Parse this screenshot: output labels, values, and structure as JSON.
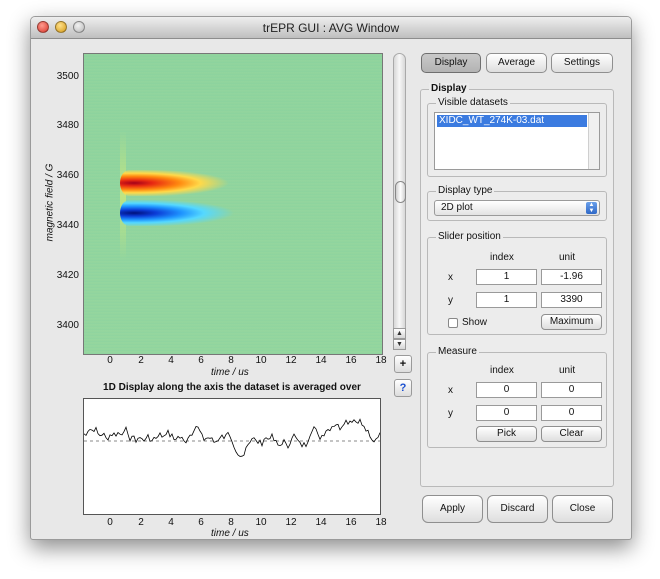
{
  "window": {
    "title": "trEPR GUI : AVG Window"
  },
  "main_plot": {
    "ylabel": "magnetic field / G",
    "xlabel": "time / us",
    "yticks": [
      "3500",
      "3480",
      "3460",
      "3440",
      "3420",
      "3400"
    ],
    "xticks": [
      "0",
      "2",
      "4",
      "6",
      "8",
      "10",
      "12",
      "14",
      "16",
      "18"
    ],
    "colormap": "jet"
  },
  "plot_buttons": {
    "add": "+",
    "help": "?"
  },
  "plot1d": {
    "caption": "1D Display along the axis the dataset is averaged over",
    "xlabel": "time / us",
    "xticks": [
      "0",
      "2",
      "4",
      "6",
      "8",
      "10",
      "12",
      "14",
      "16",
      "18"
    ]
  },
  "tabs": [
    {
      "label": "Display",
      "selected": true
    },
    {
      "label": "Average",
      "selected": false
    },
    {
      "label": "Settings",
      "selected": false
    }
  ],
  "display_panel": {
    "title": "Display",
    "visible_datasets": {
      "title": "Visible datasets",
      "items": [
        "XIDC_WT_274K-03.dat"
      ]
    },
    "display_type": {
      "title": "Display type",
      "value": "2D plot"
    },
    "slider_position": {
      "title": "Slider position",
      "col_index": "index",
      "col_unit": "unit",
      "row_x": "x",
      "row_y": "y",
      "x_index": "1",
      "x_unit": "-1.96",
      "y_index": "1",
      "y_unit": "3390",
      "show_label": "Show",
      "show_checked": false,
      "maximum_label": "Maximum"
    },
    "measure": {
      "title": "Measure",
      "col_index": "index",
      "col_unit": "unit",
      "row_x": "x",
      "row_y": "y",
      "x_index": "0",
      "x_unit": "0",
      "y_index": "0",
      "y_unit": "0",
      "pick_label": "Pick",
      "clear_label": "Clear"
    }
  },
  "footer_buttons": {
    "apply": "Apply",
    "discard": "Discard",
    "close": "Close"
  }
}
